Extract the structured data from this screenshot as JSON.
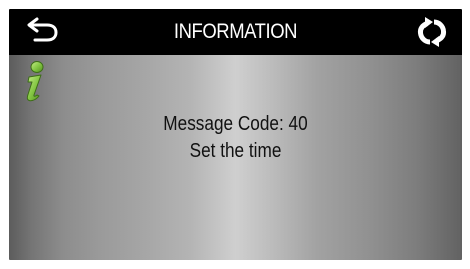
{
  "header": {
    "title": "INFORMATION",
    "back_icon": "back-arrow-icon",
    "refresh_icon": "refresh-icon"
  },
  "content": {
    "info_icon": "info-icon",
    "message_code_line": "Message Code: 40",
    "message_text": "Set the time"
  },
  "colors": {
    "header_bg": "#000000",
    "header_text": "#ffffff",
    "icon_green": "#7fc242",
    "text": "#111111"
  }
}
